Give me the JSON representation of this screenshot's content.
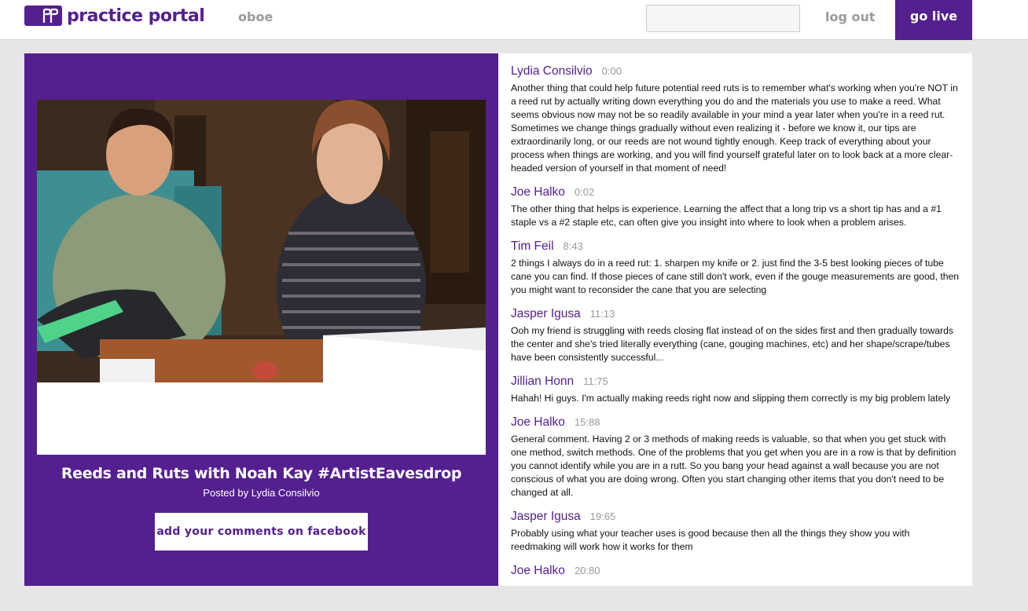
{
  "header": {
    "logo_text": "practice portal",
    "nav_instrument": "oboe",
    "search": {
      "value": "",
      "placeholder": ""
    },
    "logout_label": "log out",
    "golive_label": "go live",
    "brand_color": "#54208f"
  },
  "video": {
    "title": "Reeds and Ruts with Noah Kay #ArtistEavesdrop",
    "byline": "Posted by Lydia Consilvio",
    "facebook_button": "add your comments on facebook"
  },
  "comments": [
    {
      "author": "Lydia Consilvio",
      "time": "0:00",
      "text": "Another thing that could help future potential reed ruts is to remember what's working when you're NOT in a reed rut by actually writing down everything you do and the materials you use to make a reed. What seems obvious now may not be so readily available in your mind a year later when you're in a reed rut. Sometimes we change things gradually without even realizing it - before we know it, our tips are extraordinarily long, or our reeds are not wound tightly enough. Keep track of everything about your process when things are working, and you will find yourself grateful later on to look back at a more clear-headed version of yourself in that moment of need!"
    },
    {
      "author": "Joe Halko",
      "time": "0:02",
      "text": "The other thing that helps is experience. Learning the affect that a long trip vs a short tip has and a #1 staple vs a #2 staple etc, can often give you insight into where to look when a problem arises."
    },
    {
      "author": "Tim Feil",
      "time": "8:43",
      "text": "2 things I always do in a reed rut: 1. sharpen my knife or 2. just find the 3-5 best looking pieces of tube cane you can find. If those pieces of cane still don't work, even if the gouge measurements are good, then you might want to reconsider the cane that you are selecting"
    },
    {
      "author": "Jasper Igusa",
      "time": "11:13",
      "text": "Ooh my friend is struggling with reeds closing flat instead of on the sides first and then gradually towards the center and she's tried literally everything (cane, gouging machines, etc) and her shape/scrape/tubes have been consistently successful..."
    },
    {
      "author": "Jillian Honn",
      "time": "11:75",
      "text": "Hahah! Hi guys. I'm actually making reeds right now and slipping them correctly is my big problem lately"
    },
    {
      "author": "Joe Halko",
      "time": "15:88",
      "text": "General comment. Having 2 or 3 methods of making reeds is valuable, so that when you get stuck with one method, switch methods. One of the problems that you get when you are in a row is that by definition you cannot identify while you are in a rutt. So you bang your head against a wall because you are not conscious of what you are doing wrong. Often you start changing other items that you don't need to be changed at all."
    },
    {
      "author": "Jasper Igusa",
      "time": "19:65",
      "text": "Probably using what your teacher uses is good because then all the things they show you with reedmaking will work how it works for them"
    },
    {
      "author": "Joe Halko",
      "time": "20:80",
      "text": ""
    }
  ]
}
